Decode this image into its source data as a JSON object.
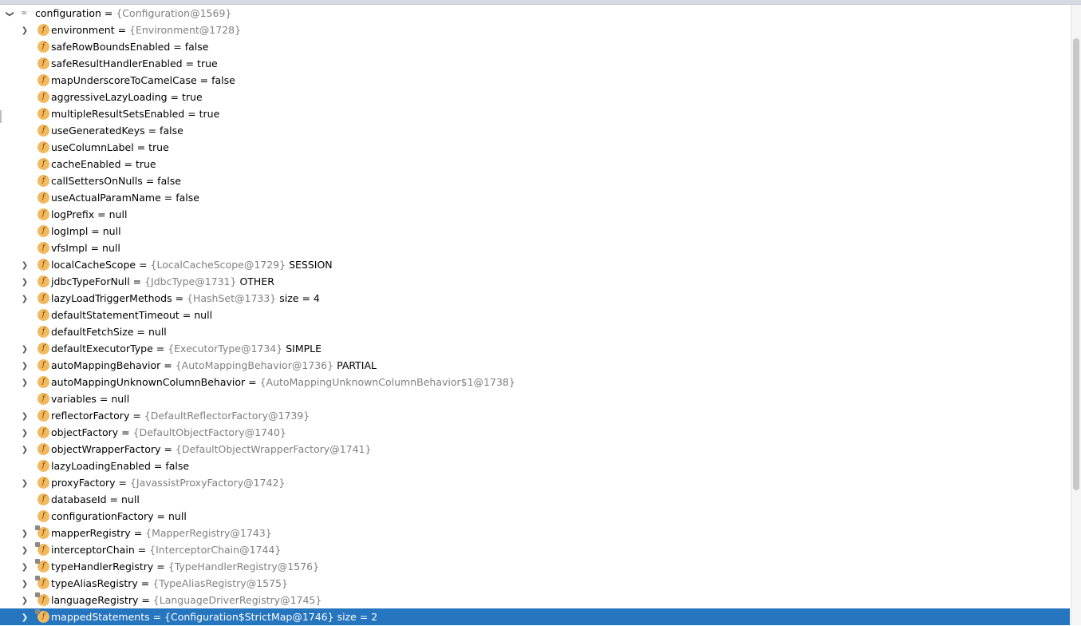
{
  "root": {
    "name": "configuration",
    "ref": "{Configuration@1569}"
  },
  "fields": [
    {
      "name": "environment",
      "ref": "{Environment@1728}",
      "value": "",
      "expandable": true,
      "lock": false
    },
    {
      "name": "safeRowBoundsEnabled",
      "ref": "",
      "value": "false",
      "expandable": false,
      "lock": false
    },
    {
      "name": "safeResultHandlerEnabled",
      "ref": "",
      "value": "true",
      "expandable": false,
      "lock": false
    },
    {
      "name": "mapUnderscoreToCamelCase",
      "ref": "",
      "value": "false",
      "expandable": false,
      "lock": false
    },
    {
      "name": "aggressiveLazyLoading",
      "ref": "",
      "value": "true",
      "expandable": false,
      "lock": false
    },
    {
      "name": "multipleResultSetsEnabled",
      "ref": "",
      "value": "true",
      "expandable": false,
      "lock": false
    },
    {
      "name": "useGeneratedKeys",
      "ref": "",
      "value": "false",
      "expandable": false,
      "lock": false
    },
    {
      "name": "useColumnLabel",
      "ref": "",
      "value": "true",
      "expandable": false,
      "lock": false
    },
    {
      "name": "cacheEnabled",
      "ref": "",
      "value": "true",
      "expandable": false,
      "lock": false
    },
    {
      "name": "callSettersOnNulls",
      "ref": "",
      "value": "false",
      "expandable": false,
      "lock": false
    },
    {
      "name": "useActualParamName",
      "ref": "",
      "value": "false",
      "expandable": false,
      "lock": false
    },
    {
      "name": "logPrefix",
      "ref": "",
      "value": "null",
      "expandable": false,
      "lock": false
    },
    {
      "name": "logImpl",
      "ref": "",
      "value": "null",
      "expandable": false,
      "lock": false
    },
    {
      "name": "vfsImpl",
      "ref": "",
      "value": "null",
      "expandable": false,
      "lock": false
    },
    {
      "name": "localCacheScope",
      "ref": "{LocalCacheScope@1729}",
      "value": "SESSION",
      "expandable": true,
      "lock": false
    },
    {
      "name": "jdbcTypeForNull",
      "ref": "{JdbcType@1731}",
      "value": "OTHER",
      "expandable": true,
      "lock": false
    },
    {
      "name": "lazyLoadTriggerMethods",
      "ref": "{HashSet@1733}",
      "value": " size = 4",
      "expandable": true,
      "lock": false
    },
    {
      "name": "defaultStatementTimeout",
      "ref": "",
      "value": "null",
      "expandable": false,
      "lock": false
    },
    {
      "name": "defaultFetchSize",
      "ref": "",
      "value": "null",
      "expandable": false,
      "lock": false
    },
    {
      "name": "defaultExecutorType",
      "ref": "{ExecutorType@1734}",
      "value": "SIMPLE",
      "expandable": true,
      "lock": false
    },
    {
      "name": "autoMappingBehavior",
      "ref": "{AutoMappingBehavior@1736}",
      "value": "PARTIAL",
      "expandable": true,
      "lock": false
    },
    {
      "name": "autoMappingUnknownColumnBehavior",
      "ref": "{AutoMappingUnknownColumnBehavior$1@1738}",
      "value": "",
      "expandable": true,
      "lock": false
    },
    {
      "name": "variables",
      "ref": "",
      "value": "null",
      "expandable": false,
      "lock": false
    },
    {
      "name": "reflectorFactory",
      "ref": "{DefaultReflectorFactory@1739}",
      "value": "",
      "expandable": true,
      "lock": false
    },
    {
      "name": "objectFactory",
      "ref": "{DefaultObjectFactory@1740}",
      "value": "",
      "expandable": true,
      "lock": false
    },
    {
      "name": "objectWrapperFactory",
      "ref": "{DefaultObjectWrapperFactory@1741}",
      "value": "",
      "expandable": true,
      "lock": false
    },
    {
      "name": "lazyLoadingEnabled",
      "ref": "",
      "value": "false",
      "expandable": false,
      "lock": false
    },
    {
      "name": "proxyFactory",
      "ref": "{JavassistProxyFactory@1742}",
      "value": "",
      "expandable": true,
      "lock": false
    },
    {
      "name": "databaseId",
      "ref": "",
      "value": "null",
      "expandable": false,
      "lock": false
    },
    {
      "name": "configurationFactory",
      "ref": "",
      "value": "null",
      "expandable": false,
      "lock": false
    },
    {
      "name": "mapperRegistry",
      "ref": "{MapperRegistry@1743}",
      "value": "",
      "expandable": true,
      "lock": true
    },
    {
      "name": "interceptorChain",
      "ref": "{InterceptorChain@1744}",
      "value": "",
      "expandable": true,
      "lock": true
    },
    {
      "name": "typeHandlerRegistry",
      "ref": "{TypeHandlerRegistry@1576}",
      "value": "",
      "expandable": true,
      "lock": true
    },
    {
      "name": "typeAliasRegistry",
      "ref": "{TypeAliasRegistry@1575}",
      "value": "",
      "expandable": true,
      "lock": true
    },
    {
      "name": "languageRegistry",
      "ref": "{LanguageDriverRegistry@1745}",
      "value": "",
      "expandable": true,
      "lock": true
    },
    {
      "name": "mappedStatements",
      "ref": "{Configuration$StrictMap@1746}",
      "value": " size = 2",
      "expandable": true,
      "lock": true,
      "selected": true
    }
  ],
  "icons": {
    "root": "watch-glasses-icon",
    "field": "field-f-icon",
    "expand": "chevron-right-icon",
    "collapse": "chevron-down-icon"
  },
  "colors": {
    "selection": "#2675bf",
    "field_icon": "#f3b95f",
    "ref_text": "#808080"
  }
}
